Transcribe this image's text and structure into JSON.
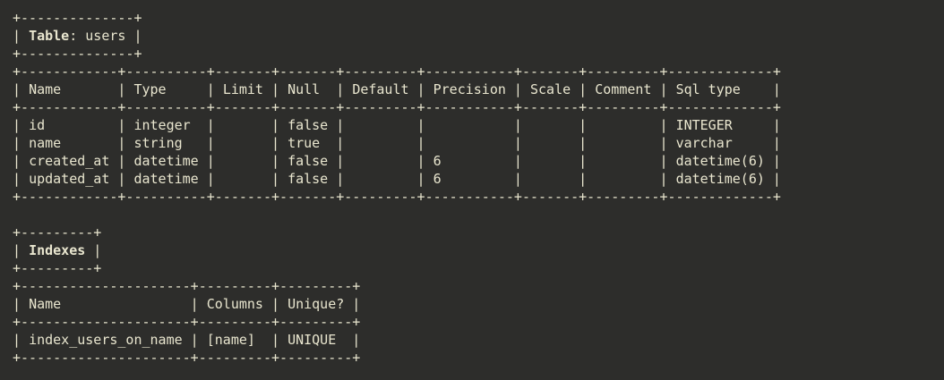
{
  "table_section": {
    "title_label": "Table",
    "title_sep": ":",
    "table_name": "users",
    "columns": [
      "Name",
      "Type",
      "Limit",
      "Null",
      "Default",
      "Precision",
      "Scale",
      "Comment",
      "Sql type"
    ],
    "rows": [
      [
        "id",
        "integer",
        "",
        "false",
        "",
        "",
        "",
        "",
        "INTEGER"
      ],
      [
        "name",
        "string",
        "",
        "true",
        "",
        "",
        "",
        "",
        "varchar"
      ],
      [
        "created_at",
        "datetime",
        "",
        "false",
        "",
        "6",
        "",
        "",
        "datetime(6)"
      ],
      [
        "updated_at",
        "datetime",
        "",
        "false",
        "",
        "6",
        "",
        "",
        "datetime(6)"
      ]
    ]
  },
  "indexes_section": {
    "title": "Indexes",
    "columns": [
      "Name",
      "Columns",
      "Unique?"
    ],
    "rows": [
      [
        "index_users_on_name",
        "[name]",
        "UNIQUE"
      ]
    ]
  }
}
